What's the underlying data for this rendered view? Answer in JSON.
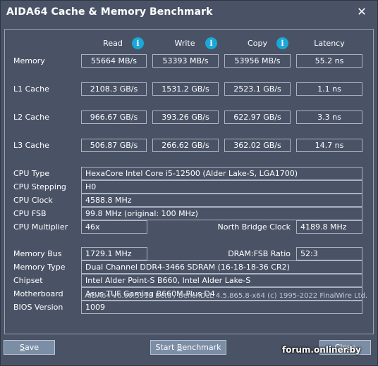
{
  "window": {
    "title": "AIDA64 Cache & Memory Benchmark",
    "close_glyph": "✕"
  },
  "columns": {
    "read": "Read",
    "write": "Write",
    "copy": "Copy",
    "latency": "Latency",
    "info_glyph": "i"
  },
  "bench": [
    {
      "label": "Memory",
      "read": "55664 MB/s",
      "write": "53393 MB/s",
      "copy": "53956 MB/s",
      "latency": "55.2 ns"
    },
    {
      "label": "L1 Cache",
      "read": "2108.3 GB/s",
      "write": "1531.2 GB/s",
      "copy": "2523.1 GB/s",
      "latency": "1.1 ns"
    },
    {
      "label": "L2 Cache",
      "read": "966.67 GB/s",
      "write": "393.26 GB/s",
      "copy": "622.97 GB/s",
      "latency": "3.3 ns"
    },
    {
      "label": "L3 Cache",
      "read": "506.87 GB/s",
      "write": "266.62 GB/s",
      "copy": "362.02 GB/s",
      "latency": "14.7 ns"
    }
  ],
  "cpu": {
    "type_label": "CPU Type",
    "type": "HexaCore Intel Core i5-12500  (Alder Lake-S, LGA1700)",
    "stepping_label": "CPU Stepping",
    "stepping": "H0",
    "clock_label": "CPU Clock",
    "clock": "4588.8 MHz",
    "fsb_label": "CPU FSB",
    "fsb": "99.8 MHz  (original: 100 MHz)",
    "multiplier_label": "CPU Multiplier",
    "multiplier": "46x",
    "nb_clock_label": "North Bridge Clock",
    "nb_clock": "4189.8 MHz"
  },
  "memory": {
    "bus_label": "Memory Bus",
    "bus": "1729.1 MHz",
    "ratio_label": "DRAM:FSB Ratio",
    "ratio": "52:3",
    "type_label": "Memory Type",
    "type": "Dual Channel DDR4-3466 SDRAM  (16-18-18-36 CR2)",
    "chipset_label": "Chipset",
    "chipset": "Intel Alder Point-S B660, Intel Alder Lake-S",
    "motherboard_label": "Motherboard",
    "motherboard": "Asus TUF Gaming B660M-Plus D4",
    "bios_label": "BIOS Version",
    "bios": "1009"
  },
  "footer": "AIDA64 v6.60.5918 Beta / BenchDLL 4.5.865.8-x64  (c) 1995-2022 FinalWire Ltd.",
  "buttons": {
    "save_pre": "",
    "save_ul": "S",
    "save_post": "ave",
    "start_pre": "Start ",
    "start_ul": "B",
    "start_post": "enchmark",
    "close": "Close"
  },
  "watermark": "forum.onliner.by"
}
